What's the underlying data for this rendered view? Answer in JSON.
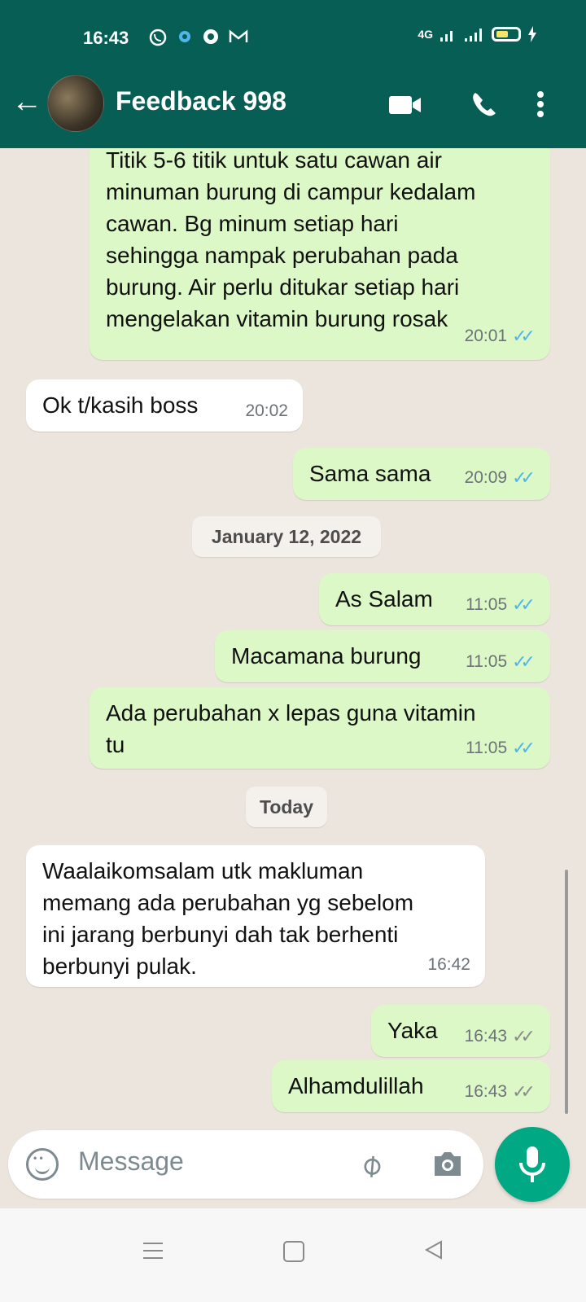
{
  "status_bar": {
    "time": "16:43",
    "network": "4G"
  },
  "header": {
    "back_label": "←",
    "title": "Feedback 998"
  },
  "messages": [
    {
      "dir": "out",
      "text": "Titik 5-6 titik untuk satu cawan air\nminuman burung di campur kedalam\ncawan. Bg minum setiap hari\nsehingga nampak perubahan pada\nburung. Air perlu ditukar setiap hari\nmengelakan vitamin burung rosak",
      "time": "20:01",
      "ticks": "blue"
    },
    {
      "dir": "in",
      "text": "Ok t/kasih boss",
      "time": "20:02"
    },
    {
      "dir": "out",
      "text": "Sama sama",
      "time": "20:09",
      "ticks": "blue"
    },
    {
      "date_chip": "January 12, 2022"
    },
    {
      "dir": "out",
      "text": "As Salam",
      "time": "11:05",
      "ticks": "blue"
    },
    {
      "dir": "out",
      "text": "Macamana burung",
      "time": "11:05",
      "ticks": "blue"
    },
    {
      "dir": "out",
      "text": "Ada perubahan x lepas guna vitamin\ntu",
      "time": "11:05",
      "ticks": "blue"
    },
    {
      "date_chip": "Today"
    },
    {
      "dir": "in",
      "text": "Waalaikomsalam utk makluman\nmemang ada perubahan yg sebelom\nini jarang berbunyi dah tak berhenti\nberbunyi pulak.",
      "time": "16:42"
    },
    {
      "dir": "out",
      "text": "Yaka",
      "time": "16:43",
      "ticks": "grey"
    },
    {
      "dir": "out",
      "text": "Alhamdulillah",
      "time": "16:43",
      "ticks": "grey"
    }
  ],
  "composer": {
    "placeholder": "Message"
  },
  "colors": {
    "header": "#075e54",
    "outgoing": "#dcf8c6",
    "incoming": "#ffffff",
    "read_ticks": "#4fb6ec",
    "mic": "#00a884"
  }
}
